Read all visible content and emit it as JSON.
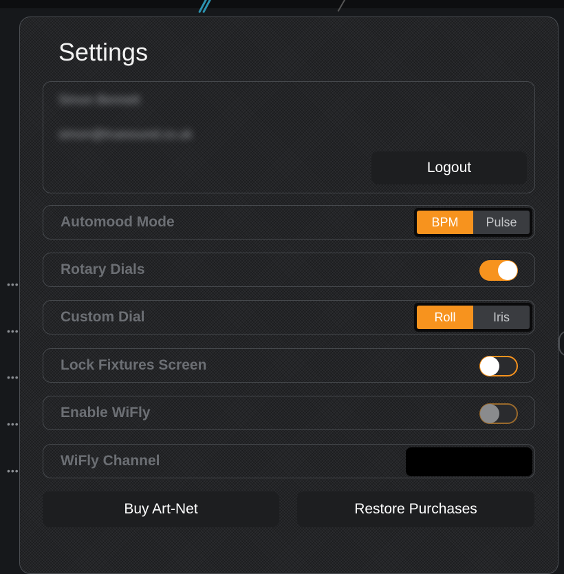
{
  "settings": {
    "title": "Settings",
    "account": {
      "name": "Simon Bennett",
      "email": "simon@truesound.co.uk",
      "logout_label": "Logout"
    },
    "rows": {
      "automood": {
        "label": "Automood Mode",
        "options": [
          "BPM",
          "Pulse"
        ],
        "selected": "BPM"
      },
      "rotary": {
        "label": "Rotary Dials",
        "toggle": "on"
      },
      "custom_dial": {
        "label": "Custom Dial",
        "options": [
          "Roll",
          "Iris"
        ],
        "selected": "Roll"
      },
      "lock_fixtures": {
        "label": "Lock Fixtures Screen",
        "toggle": "off"
      },
      "enable_wifly": {
        "label": "Enable WiFly",
        "toggle": "off-disabled"
      },
      "wifly_channel": {
        "label": "WiFly Channel",
        "value": ""
      }
    },
    "buttons": {
      "buy": "Buy Art-Net",
      "restore": "Restore Purchases"
    },
    "colors": {
      "accent": "#f7931e",
      "panel": "#2b2c2f"
    }
  },
  "background": {
    "side_dots": "•••"
  }
}
